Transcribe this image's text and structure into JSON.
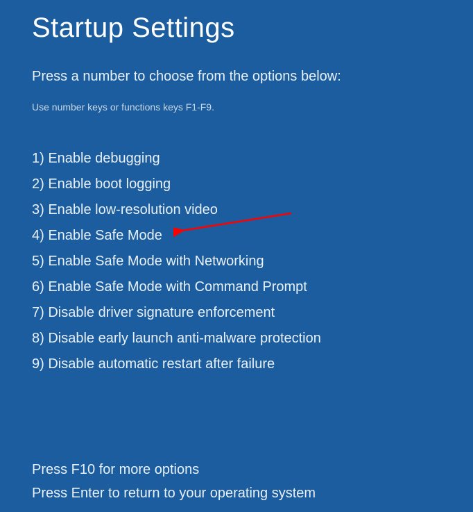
{
  "title": "Startup Settings",
  "subtitle": "Press a number to choose from the options below:",
  "hint": "Use number keys or functions keys F1-F9.",
  "options": [
    "1) Enable debugging",
    "2) Enable boot logging",
    "3) Enable low-resolution video",
    "4) Enable Safe Mode",
    "5) Enable Safe Mode with Networking",
    "6) Enable Safe Mode with Command Prompt",
    "7) Disable driver signature enforcement",
    "8) Disable early launch anti-malware protection",
    "9) Disable automatic restart after failure"
  ],
  "footer": {
    "line1": "Press F10 for more options",
    "line2": "Press Enter to return to your operating system"
  },
  "annotation": {
    "arrow_color": "#ff0000",
    "target_option_index": 3
  }
}
